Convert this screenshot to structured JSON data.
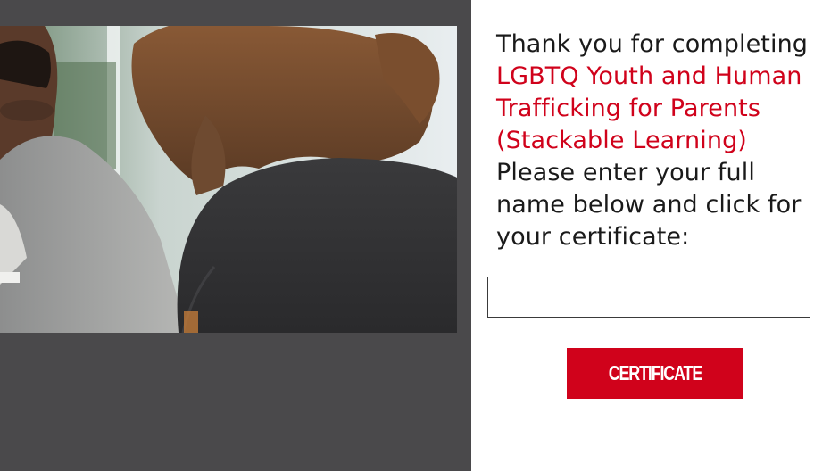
{
  "message": {
    "intro": "Thank you for completing",
    "course_line_1": "LGBTQ Youth and Human",
    "course_line_2": "Trafficking for Parents",
    "course_line_3": "(Stackable Learning)",
    "instruction_line_1": "Please enter your full",
    "instruction_line_2": "name below and click for",
    "instruction_line_3": "your certificate:"
  },
  "name_input": {
    "value": "",
    "placeholder": ""
  },
  "button": {
    "label": "CERTIFICATE"
  },
  "colors": {
    "accent": "#d0021b",
    "left_panel": "#4a494b",
    "text": "#1a1a1a"
  },
  "photo": {
    "subject": "two people in conversation"
  }
}
